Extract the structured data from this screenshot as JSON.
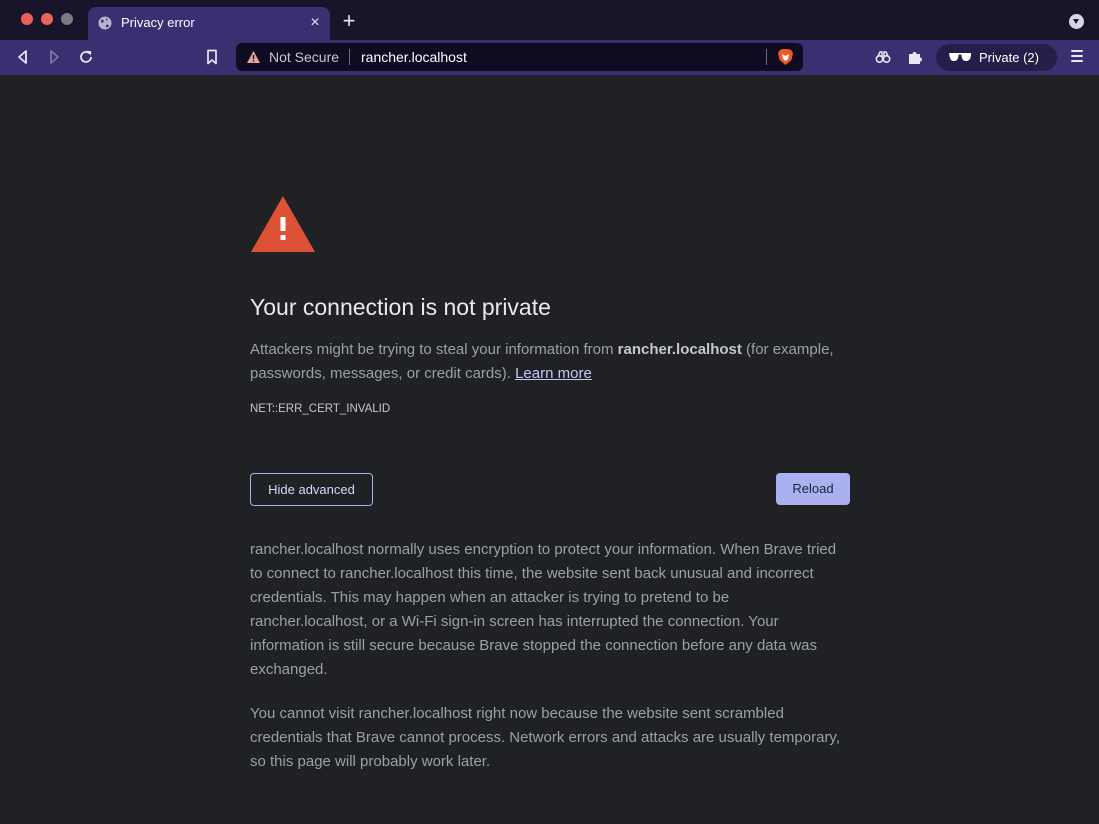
{
  "browser": {
    "tab": {
      "title": "Privacy error",
      "close_glyph": "×"
    },
    "new_tab_glyph": "+",
    "address_bar": {
      "security_label": "Not Secure",
      "url": "rancher.localhost"
    },
    "private_label": "Private (2)"
  },
  "page": {
    "heading": "Your connection is not private",
    "intro_pre": "Attackers might be trying to steal your information from ",
    "intro_host": "rancher.localhost",
    "intro_post": " (for example, passwords, messages, or credit cards). ",
    "learn_more": "Learn more",
    "error_code": "NET::ERR_CERT_INVALID",
    "hide_advanced": "Hide advanced",
    "reload": "Reload",
    "details_p1": "rancher.localhost normally uses encryption to protect your information. When Brave tried to connect to rancher.localhost this time, the website sent back unusual and incorrect credentials. This may happen when an attacker is trying to pretend to be rancher.localhost, or a Wi-Fi sign-in screen has interrupted the connection. Your information is still secure because Brave stopped the connection before any data was exchanged.",
    "details_p2": "You cannot visit rancher.localhost right now because the website sent scrambled credentials that Brave cannot process. Network errors and attacks are usually temporary, so this page will probably work later."
  },
  "colors": {
    "page_bg": "#202124",
    "toolbar_bg": "#3b2f71",
    "warning_red": "#dd5235",
    "accent": "#aab1ef"
  },
  "icons": {
    "tab_favicon": "globe-icon",
    "back": "back-arrow-icon",
    "forward": "forward-arrow-icon",
    "reload": "reload-icon",
    "bookmark": "bookmark-icon",
    "security": "warning-triangle-icon",
    "shields": "brave-lion-icon",
    "wallet": "binoculars-icon",
    "extensions": "puzzle-icon",
    "private": "sunglasses-icon",
    "menu": "hamburger-menu-icon"
  }
}
